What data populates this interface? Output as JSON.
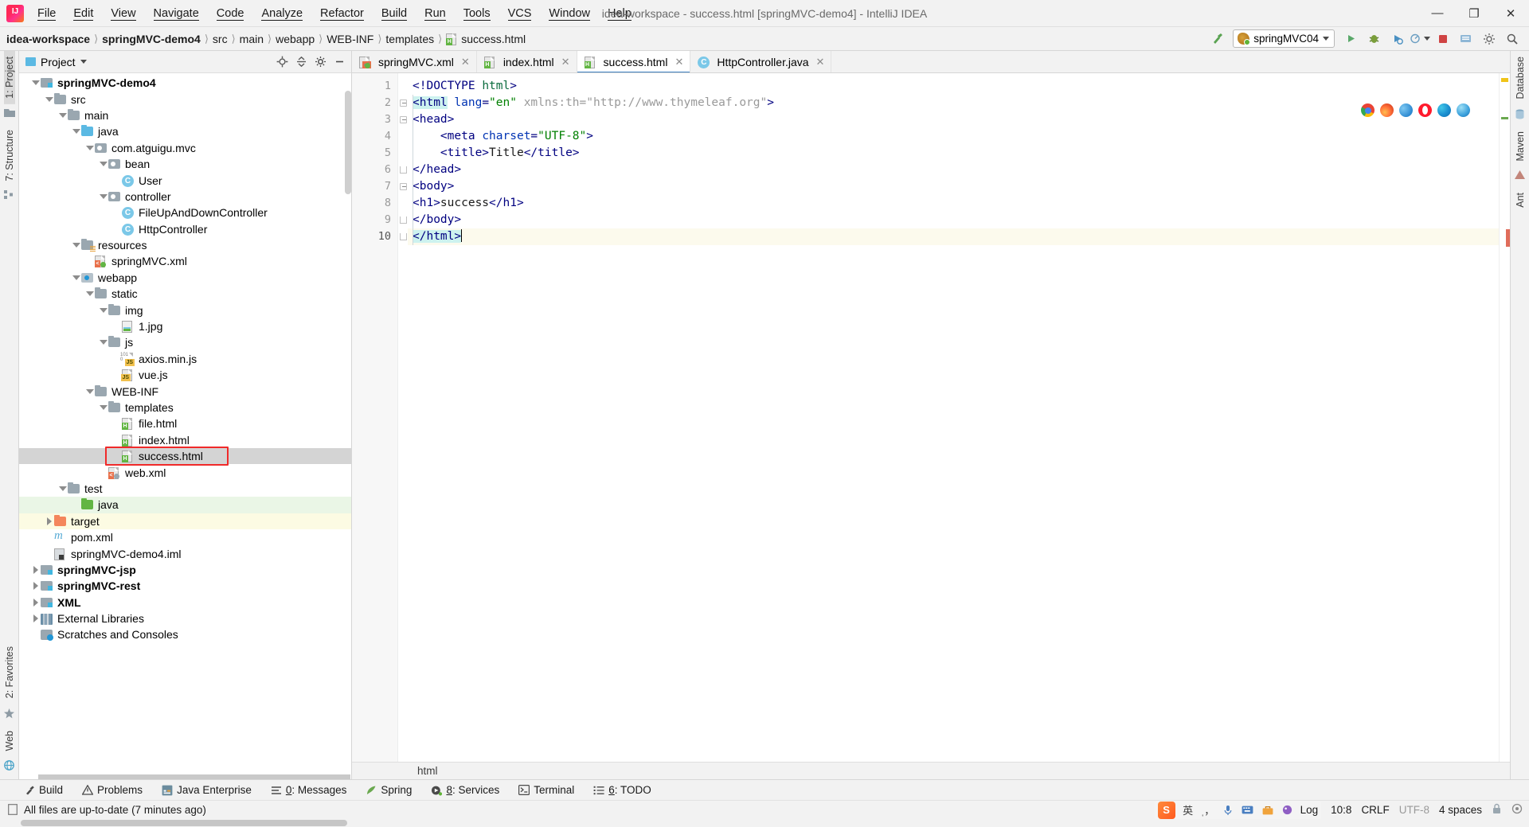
{
  "window": {
    "title": "idea-workspace - success.html [springMVC-demo4] - IntelliJ IDEA",
    "logo": "intellij-idea-logo",
    "minimize": "—",
    "maximize": "❐",
    "close": "✕"
  },
  "menu": [
    {
      "label": "File",
      "mnemonic": "F"
    },
    {
      "label": "Edit",
      "mnemonic": "E"
    },
    {
      "label": "View",
      "mnemonic": "V"
    },
    {
      "label": "Navigate",
      "mnemonic": "N"
    },
    {
      "label": "Code",
      "mnemonic": "C"
    },
    {
      "label": "Analyze",
      "mnemonic": "z"
    },
    {
      "label": "Refactor",
      "mnemonic": "R"
    },
    {
      "label": "Build",
      "mnemonic": "B"
    },
    {
      "label": "Run",
      "mnemonic": "u"
    },
    {
      "label": "Tools",
      "mnemonic": "T"
    },
    {
      "label": "VCS",
      "mnemonic": "S"
    },
    {
      "label": "Window",
      "mnemonic": "W"
    },
    {
      "label": "Help",
      "mnemonic": "H"
    }
  ],
  "breadcrumb": [
    {
      "label": "idea-workspace",
      "bold": true
    },
    {
      "label": "springMVC-demo4",
      "bold": true
    },
    {
      "label": "src",
      "bold": false
    },
    {
      "label": "main",
      "bold": false
    },
    {
      "label": "webapp",
      "bold": false
    },
    {
      "label": "WEB-INF",
      "bold": false
    },
    {
      "label": "templates",
      "bold": false
    },
    {
      "label": "success.html",
      "bold": false,
      "icon": "html-file-icon"
    }
  ],
  "toolbar": {
    "build_icon": "hammer-build-icon",
    "run_config": "springMVC04",
    "run_icon": "run-icon",
    "debug_icon": "debug-icon",
    "run_with_coverage_icon": "run-coverage-icon",
    "profile_icon": "profiler-icon",
    "stop_icon": "stop-icon",
    "updates_icon": "update-project-icon",
    "settings_icon": "settings-icon",
    "search_icon": "search-everywhere-icon"
  },
  "left_strip": {
    "tabs": [
      {
        "label": "1: Project",
        "active": true
      },
      {
        "label": "7: Structure",
        "active": false
      }
    ],
    "bottom_tabs": [
      {
        "label": "2: Favorites"
      },
      {
        "label": "Web"
      }
    ]
  },
  "right_strip": {
    "tabs": [
      {
        "label": "Database"
      },
      {
        "label": "Maven"
      },
      {
        "label": "Ant"
      }
    ]
  },
  "project_pane": {
    "title": "Project",
    "dropdown_icon": "chevron-down-icon",
    "actions": [
      "locate-icon",
      "collapse-all-icon",
      "settings-icon",
      "hide-icon"
    ],
    "tree": [
      {
        "label": "springMVC-demo4",
        "depth": 0,
        "arrow": "down",
        "icon": "module-folder-icon",
        "bold": true
      },
      {
        "label": "src",
        "depth": 1,
        "arrow": "down",
        "icon": "folder-icon"
      },
      {
        "label": "main",
        "depth": 2,
        "arrow": "down",
        "icon": "folder-icon"
      },
      {
        "label": "java",
        "depth": 3,
        "arrow": "down",
        "icon": "source-folder-icon"
      },
      {
        "label": "com.atguigu.mvc",
        "depth": 4,
        "arrow": "down",
        "icon": "package-icon"
      },
      {
        "label": "bean",
        "depth": 5,
        "arrow": "down",
        "icon": "package-icon"
      },
      {
        "label": "User",
        "depth": 6,
        "arrow": "none",
        "icon": "java-class-icon"
      },
      {
        "label": "controller",
        "depth": 5,
        "arrow": "down",
        "icon": "package-icon"
      },
      {
        "label": "FileUpAndDownController",
        "depth": 6,
        "arrow": "none",
        "icon": "java-class-icon"
      },
      {
        "label": "HttpController",
        "depth": 6,
        "arrow": "none",
        "icon": "java-class-icon"
      },
      {
        "label": "resources",
        "depth": 3,
        "arrow": "down",
        "icon": "resources-folder-icon"
      },
      {
        "label": "springMVC.xml",
        "depth": 4,
        "arrow": "none",
        "icon": "spring-xml-icon"
      },
      {
        "label": "webapp",
        "depth": 3,
        "arrow": "down",
        "icon": "webapp-folder-icon"
      },
      {
        "label": "static",
        "depth": 4,
        "arrow": "down",
        "icon": "folder-icon"
      },
      {
        "label": "img",
        "depth": 5,
        "arrow": "down",
        "icon": "folder-icon"
      },
      {
        "label": "1.jpg",
        "depth": 6,
        "arrow": "none",
        "icon": "image-file-icon"
      },
      {
        "label": "js",
        "depth": 5,
        "arrow": "down",
        "icon": "folder-icon"
      },
      {
        "label": "axios.min.js",
        "depth": 6,
        "arrow": "none",
        "icon": "minified-js-file-icon"
      },
      {
        "label": "vue.js",
        "depth": 6,
        "arrow": "none",
        "icon": "js-file-icon"
      },
      {
        "label": "WEB-INF",
        "depth": 4,
        "arrow": "down",
        "icon": "folder-icon"
      },
      {
        "label": "templates",
        "depth": 5,
        "arrow": "down",
        "icon": "folder-icon"
      },
      {
        "label": "file.html",
        "depth": 6,
        "arrow": "none",
        "icon": "html-file-icon"
      },
      {
        "label": "index.html",
        "depth": 6,
        "arrow": "none",
        "icon": "html-file-icon"
      },
      {
        "label": "success.html",
        "depth": 6,
        "arrow": "none",
        "icon": "html-file-icon",
        "selected": true,
        "highlighted": true
      },
      {
        "label": "web.xml",
        "depth": 5,
        "arrow": "none",
        "icon": "web-xml-icon"
      },
      {
        "label": "test",
        "depth": 2,
        "arrow": "down",
        "icon": "folder-icon"
      },
      {
        "label": "java",
        "depth": 3,
        "arrow": "none",
        "icon": "test-source-folder-icon",
        "rowColor": "green"
      },
      {
        "label": "target",
        "depth": 1,
        "arrow": "right",
        "icon": "excluded-folder-icon",
        "rowColor": "yellow"
      },
      {
        "label": "pom.xml",
        "depth": 1,
        "arrow": "none",
        "icon": "maven-pom-icon"
      },
      {
        "label": "springMVC-demo4.iml",
        "depth": 1,
        "arrow": "none",
        "icon": "iml-file-icon"
      },
      {
        "label": "springMVC-jsp",
        "depth": 0,
        "arrow": "right",
        "icon": "module-folder-icon",
        "bold": true
      },
      {
        "label": "springMVC-rest",
        "depth": 0,
        "arrow": "right",
        "icon": "module-folder-icon",
        "bold": true
      },
      {
        "label": "XML",
        "depth": 0,
        "arrow": "right",
        "icon": "module-folder-icon",
        "bold": true
      },
      {
        "label": "External Libraries",
        "depth": -1,
        "arrow": "right",
        "icon": "external-libraries-icon"
      },
      {
        "label": "Scratches and Consoles",
        "depth": -1,
        "arrow": "none",
        "icon": "scratches-icon"
      }
    ]
  },
  "editor": {
    "tabs": [
      {
        "label": "springMVC.xml",
        "icon": "spring-xml-icon",
        "active": false
      },
      {
        "label": "index.html",
        "icon": "html-file-icon",
        "active": false
      },
      {
        "label": "success.html",
        "icon": "html-file-icon",
        "active": true
      },
      {
        "label": "HttpController.java",
        "icon": "java-class-icon",
        "active": false
      }
    ],
    "close_glyph": "✕",
    "lines": [
      {
        "n": 1,
        "fold": "none"
      },
      {
        "n": 2,
        "fold": "open"
      },
      {
        "n": 3,
        "fold": "open"
      },
      {
        "n": 4,
        "fold": "none"
      },
      {
        "n": 5,
        "fold": "none"
      },
      {
        "n": 6,
        "fold": "close"
      },
      {
        "n": 7,
        "fold": "open"
      },
      {
        "n": 8,
        "fold": "none"
      },
      {
        "n": 9,
        "fold": "close"
      },
      {
        "n": 10,
        "fold": "close",
        "current": true
      }
    ],
    "code_text": [
      "<!DOCTYPE html>",
      "<html lang=\"en\" xmlns:th=\"http://www.thymeleaf.org\">",
      "<head>",
      "    <meta charset=\"UTF-8\">",
      "    <title>Title</title>",
      "</head>",
      "<body>",
      "<h1>success</h1>",
      "</body>",
      "</html>"
    ],
    "breadcrumb_bottom": "html",
    "browsers": [
      "chrome",
      "firefox",
      "edge-legacy",
      "opera",
      "edge",
      "internet-explorer"
    ]
  },
  "bottom_toolwindows": [
    {
      "label": "Build",
      "icon": "build-hammer-icon",
      "mnemonic": ""
    },
    {
      "label": "Problems",
      "icon": "warning-triangle-icon",
      "mnemonic": ""
    },
    {
      "label": "Java Enterprise",
      "icon": "java-enterprise-icon",
      "mnemonic": ""
    },
    {
      "label": "0: Messages",
      "icon": "messages-icon",
      "mnemonic": "0"
    },
    {
      "label": "Spring",
      "icon": "spring-leaf-icon",
      "mnemonic": ""
    },
    {
      "label": "8: Services",
      "icon": "services-icon",
      "mnemonic": "8"
    },
    {
      "label": "Terminal",
      "icon": "terminal-icon",
      "mnemonic": ""
    },
    {
      "label": "6: TODO",
      "icon": "todo-list-icon",
      "mnemonic": "6"
    }
  ],
  "status": {
    "message": "All files are up-to-date (7 minutes ago)",
    "message_icon": "document-icon",
    "caret": "10:8",
    "line_separator": "CRLF",
    "encoding": "UTF-8",
    "indent": "4 spaces",
    "lock_icon": "read-only-lock-icon",
    "inspection_icon": "inspections-icon",
    "ime": {
      "app": "sogou-input-icon",
      "mode": "英",
      "punctuation": "ˌ，",
      "voice": "microphone-icon",
      "keyboard": "keyboard-icon",
      "toolbox": "toolbox-icon",
      "skin": "skin-icon",
      "log": "Log"
    }
  }
}
